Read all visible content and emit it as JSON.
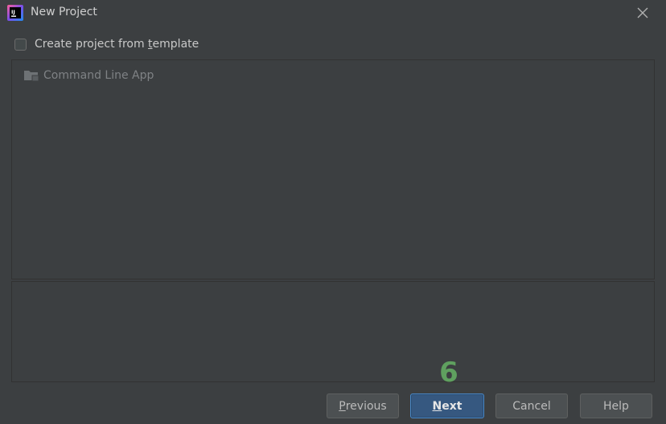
{
  "window": {
    "title": "New Project",
    "icon": "intellij-idea-icon",
    "close_icon": "close-icon"
  },
  "template_option": {
    "checked": false,
    "label_pre": "Create project from ",
    "label_mnemonic": "t",
    "label_post": "emplate"
  },
  "template_list": {
    "items": [
      {
        "label": "Command Line App",
        "icon": "folder-icon",
        "enabled": false
      }
    ]
  },
  "description": {
    "text": ""
  },
  "annotation": {
    "step": "6",
    "color": "#5fa05f"
  },
  "buttons": {
    "previous": {
      "mnemonic": "P",
      "rest": "revious"
    },
    "next": {
      "mnemonic": "N",
      "rest": "ext"
    },
    "cancel": {
      "label": "Cancel"
    },
    "help": {
      "label": "Help"
    }
  },
  "colors": {
    "background": "#3c3f41",
    "primary_button": "#365880",
    "primary_border": "#4a88c7"
  }
}
